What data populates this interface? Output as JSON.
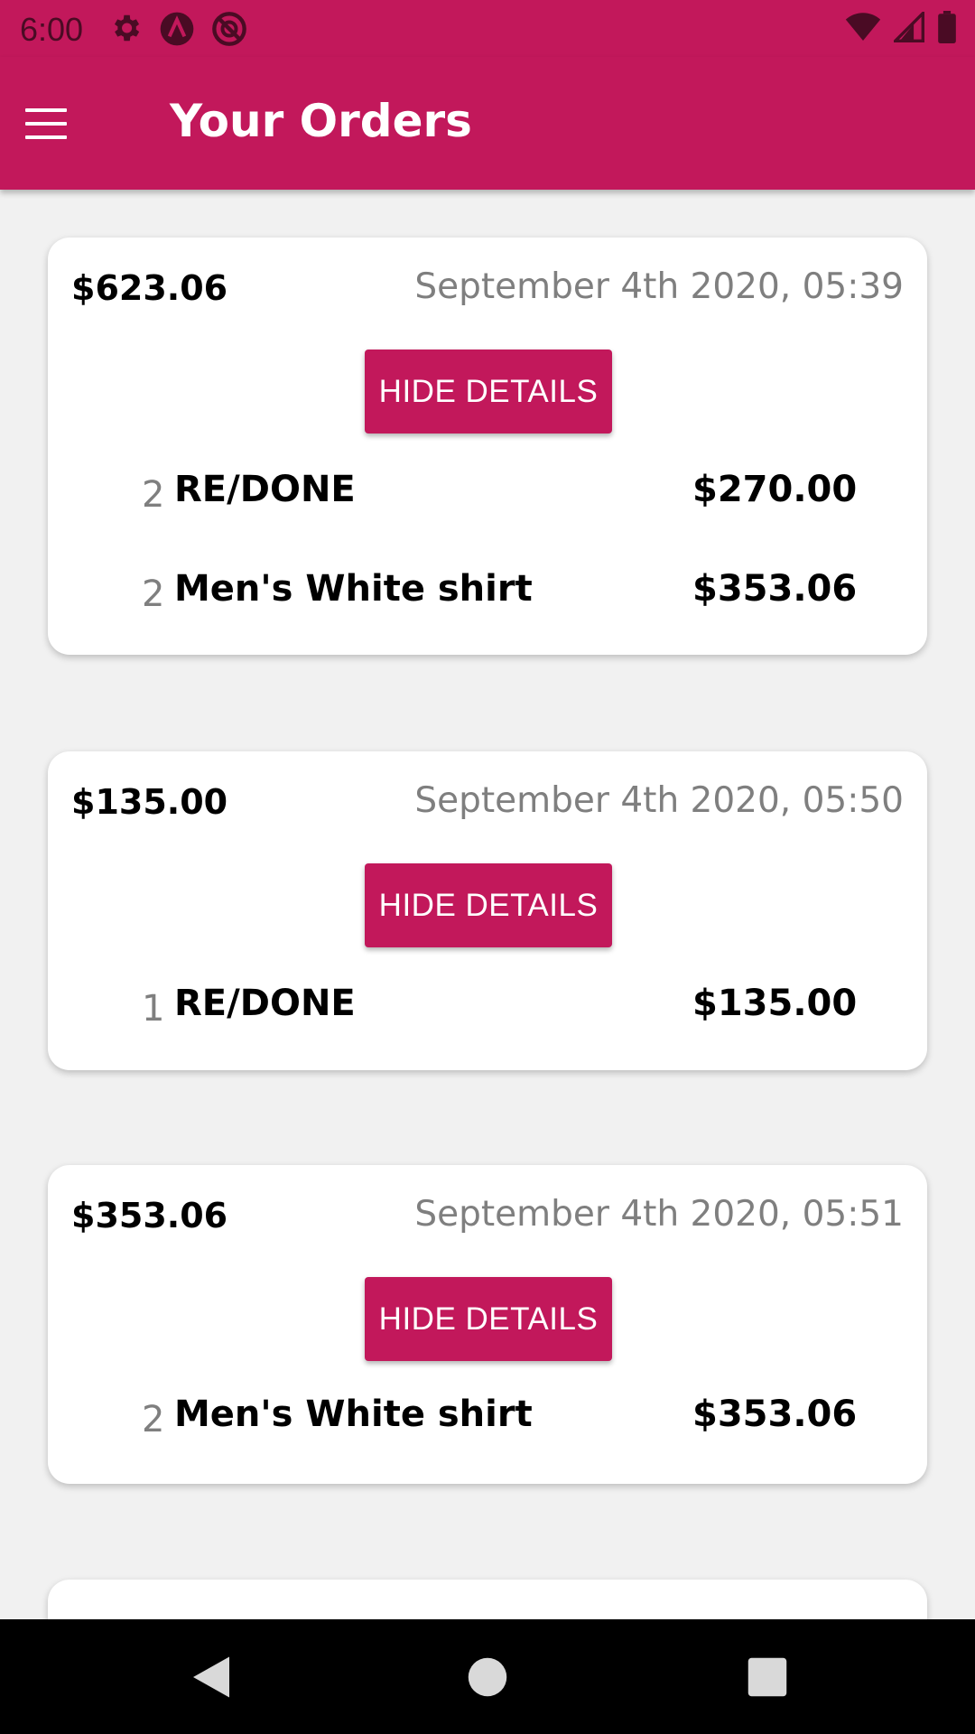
{
  "status_bar": {
    "time": "6:00",
    "left_icons": [
      "gear-icon",
      "app-a-icon",
      "no-disturb-icon"
    ],
    "right_icons": [
      "wifi-icon",
      "cell-signal-icon",
      "battery-icon"
    ]
  },
  "app_bar": {
    "title": "Your Orders",
    "menu_icon": "hamburger-menu-icon"
  },
  "colors": {
    "primary": "#c2185b",
    "background": "#f1f1f1",
    "card": "#ffffff",
    "muted": "#7f7f7f"
  },
  "orders": [
    {
      "total": "$623.06",
      "date": "September 4th 2020, 05:39",
      "button_label": "HIDE DETAILS",
      "items": [
        {
          "qty": "2",
          "name": "RE/DONE",
          "price": "$270.00"
        },
        {
          "qty": "2",
          "name": "Men's White shirt",
          "price": "$353.06"
        }
      ]
    },
    {
      "total": "$135.00",
      "date": "September 4th 2020, 05:50",
      "button_label": "HIDE DETAILS",
      "items": [
        {
          "qty": "1",
          "name": "RE/DONE",
          "price": "$135.00"
        }
      ]
    },
    {
      "total": "$353.06",
      "date": "September 4th 2020, 05:51",
      "button_label": "HIDE DETAILS",
      "items": [
        {
          "qty": "2",
          "name": "Men's White shirt",
          "price": "$353.06"
        }
      ]
    }
  ],
  "nav_bar": {
    "buttons": [
      "back-icon",
      "home-icon",
      "recents-icon"
    ]
  }
}
